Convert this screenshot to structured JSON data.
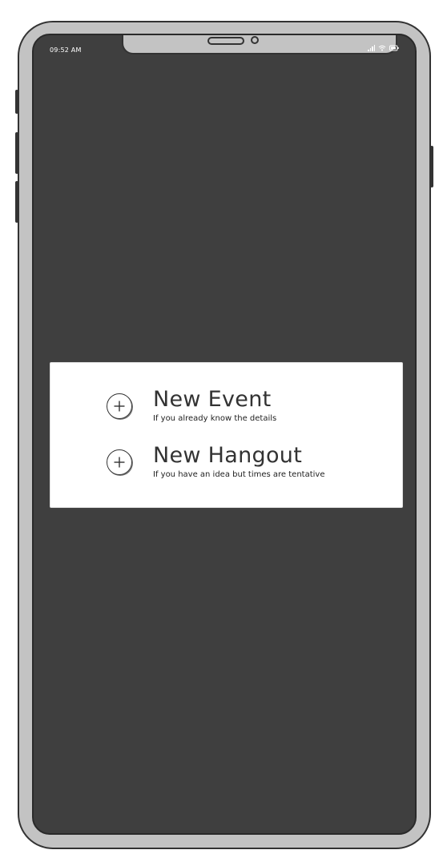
{
  "status_bar": {
    "time": "09:52 AM",
    "icons": [
      "signal-icon",
      "wifi-icon",
      "battery-icon"
    ]
  },
  "menu": {
    "items": [
      {
        "icon": "plus-circle-icon",
        "title": "New Event",
        "subtitle": "If you already know the details"
      },
      {
        "icon": "plus-circle-icon",
        "title": "New Hangout",
        "subtitle": "If you have an idea but times are tentative"
      }
    ]
  },
  "colors": {
    "screen_background": "#3f3f3f",
    "frame": "#c3c3c3",
    "card": "#ffffff",
    "text": "#333333"
  }
}
